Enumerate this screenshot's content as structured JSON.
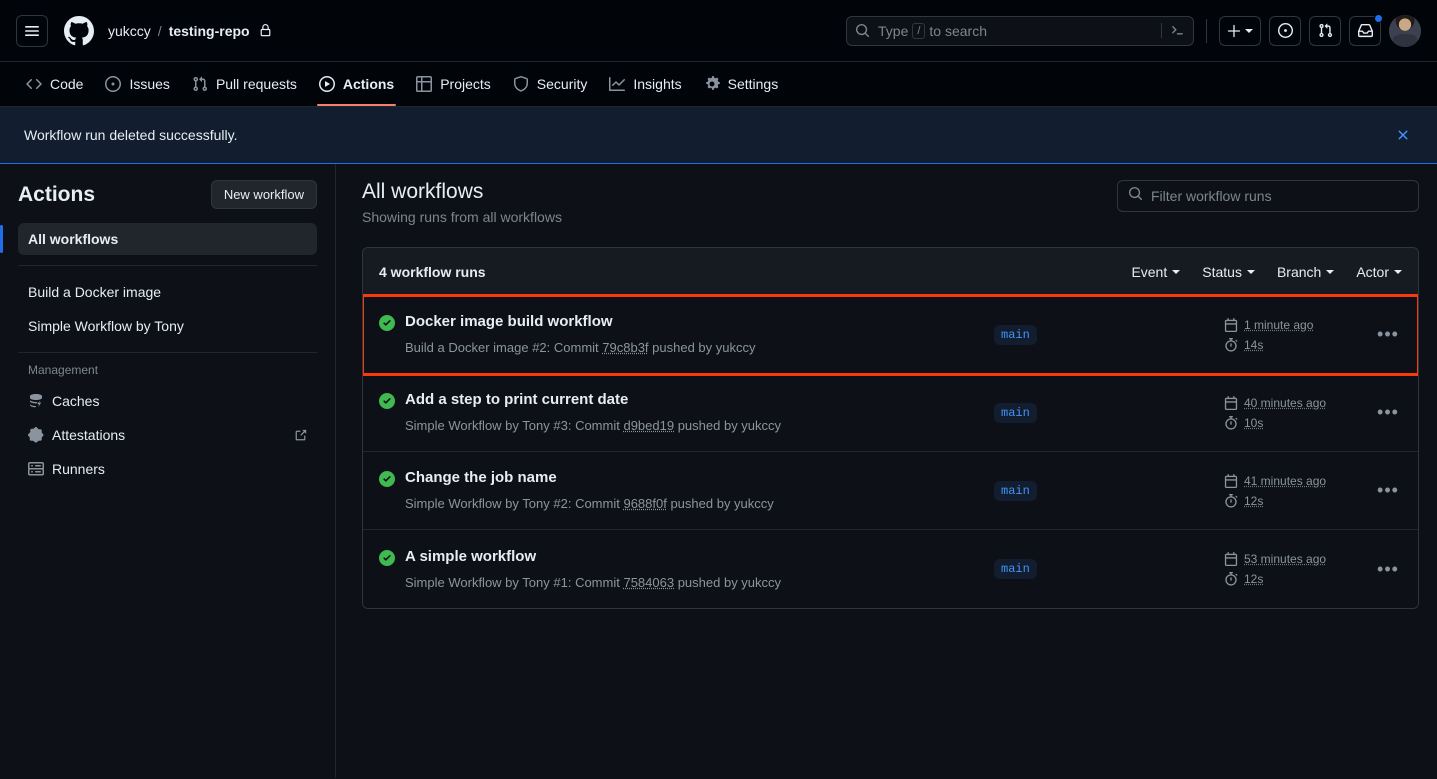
{
  "header": {
    "menu_label": "hamburger-menu",
    "owner": "yukccy",
    "separator": "/",
    "repo": "testing-repo",
    "search_placeholder_prefix": "Type",
    "search_slash_key": "/",
    "search_placeholder_suffix": "to search"
  },
  "nav": {
    "items": [
      {
        "label": "Code",
        "icon": "code-icon",
        "active": false
      },
      {
        "label": "Issues",
        "icon": "issue-opened-icon",
        "active": false
      },
      {
        "label": "Pull requests",
        "icon": "git-pull-request-icon",
        "active": false
      },
      {
        "label": "Actions",
        "icon": "play-icon",
        "active": true
      },
      {
        "label": "Projects",
        "icon": "table-icon",
        "active": false
      },
      {
        "label": "Security",
        "icon": "shield-icon",
        "active": false
      },
      {
        "label": "Insights",
        "icon": "graph-icon",
        "active": false
      },
      {
        "label": "Settings",
        "icon": "gear-icon",
        "active": false
      }
    ]
  },
  "flash": {
    "message": "Workflow run deleted successfully.",
    "close_label": "×",
    "border_color": "#1f6feb",
    "background": "#121d2f"
  },
  "sidebar": {
    "title": "Actions",
    "new_workflow_label": "New workflow",
    "all_workflows": "All workflows",
    "workflows": [
      {
        "label": "Build a Docker image"
      },
      {
        "label": "Simple Workflow by Tony"
      }
    ],
    "management_label": "Management",
    "management_items": [
      {
        "label": "Caches",
        "icon": "cache-icon",
        "external": false
      },
      {
        "label": "Attestations",
        "icon": "verified-icon",
        "external": true
      },
      {
        "label": "Runners",
        "icon": "server-icon",
        "external": false
      }
    ]
  },
  "main": {
    "title": "All workflows",
    "subtitle": "Showing runs from all workflows",
    "filter_placeholder": "Filter workflow runs",
    "filter_value": "",
    "runs_count_label": "4 workflow runs",
    "filters": [
      {
        "label": "Event"
      },
      {
        "label": "Status"
      },
      {
        "label": "Branch"
      },
      {
        "label": "Actor"
      }
    ],
    "runs": [
      {
        "title": "Docker image build workflow",
        "workflow": "Build a Docker image",
        "run_number": "#2",
        "commit_prefix": ": Commit ",
        "commit": "79c8b3f",
        "pushed_by": " pushed by yukccy",
        "branch": "main",
        "time_ago": "1 minute ago",
        "duration": "14s",
        "status": "success",
        "highlighted": true
      },
      {
        "title": "Add a step to print current date",
        "workflow": "Simple Workflow by Tony",
        "run_number": "#3",
        "commit_prefix": ": Commit ",
        "commit": "d9bed19",
        "pushed_by": " pushed by yukccy",
        "branch": "main",
        "time_ago": "40 minutes ago",
        "duration": "10s",
        "status": "success",
        "highlighted": false
      },
      {
        "title": "Change the job name",
        "workflow": "Simple Workflow by Tony",
        "run_number": "#2",
        "commit_prefix": ": Commit ",
        "commit": "9688f0f",
        "pushed_by": " pushed by yukccy",
        "branch": "main",
        "time_ago": "41 minutes ago",
        "duration": "12s",
        "status": "success",
        "highlighted": false
      },
      {
        "title": "A simple workflow",
        "workflow": "Simple Workflow by Tony",
        "run_number": "#1",
        "commit_prefix": ": Commit ",
        "commit": "7584063",
        "pushed_by": " pushed by yukccy",
        "branch": "main",
        "time_ago": "53 minutes ago",
        "duration": "12s",
        "status": "success",
        "highlighted": false
      }
    ],
    "kebab_label": "•••"
  },
  "colors": {
    "page_bg": "#0d1117",
    "header_bg": "#010409",
    "accent_active_tab": "#f78166",
    "success_green": "#3fb950",
    "highlight_red": "#fa3a0a",
    "link_blue": "#4493f8",
    "border": "#30363d"
  }
}
